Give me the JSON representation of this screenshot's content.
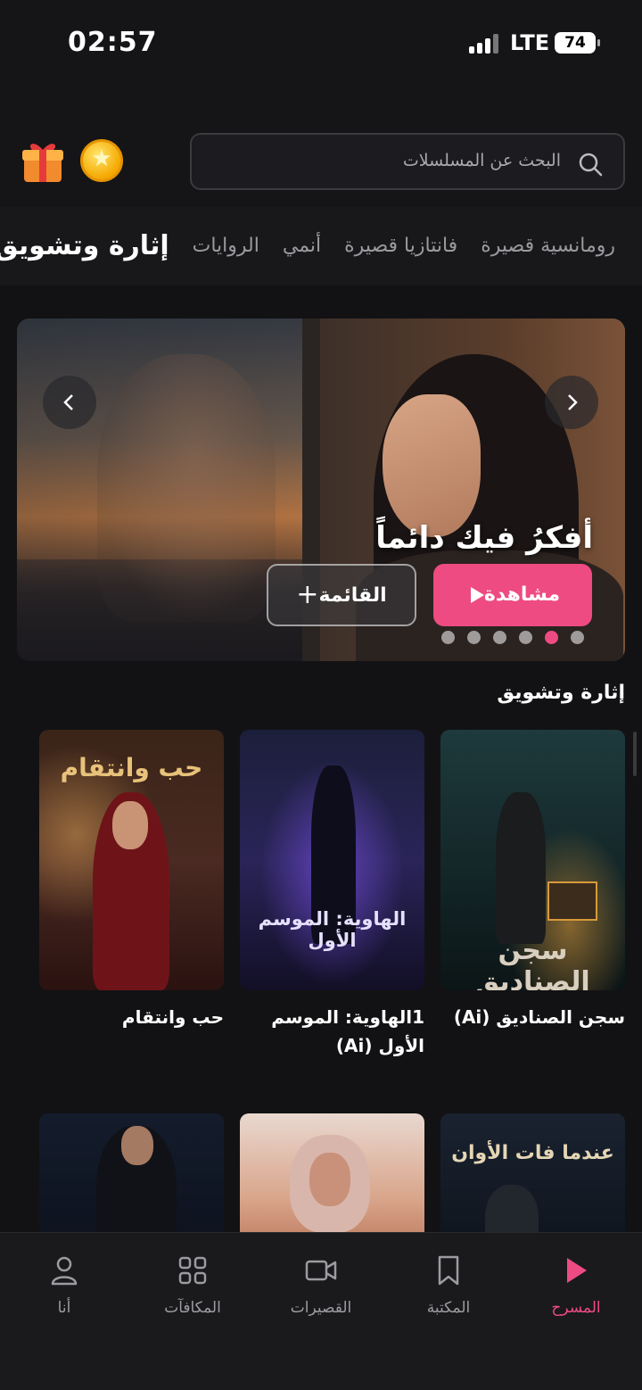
{
  "status_bar": {
    "time": "02:57",
    "network": "LTE",
    "battery": "74"
  },
  "header": {
    "search_placeholder": "البحث عن المسلسلات"
  },
  "tabs": [
    "إثارة وتشويق",
    "الروايات",
    "أنمي",
    "فانتازيا قصيرة",
    "رومانسية قصيرة"
  ],
  "hero": {
    "title": "أفكرُ فيك دائماً",
    "watch_label": "مشاهدة",
    "list_label": "القائمة",
    "slide_count": 6,
    "active_slide": 2
  },
  "section": {
    "title": "إثارة وتشويق",
    "cards": [
      {
        "title": "سجن الصناديق  (Ai)",
        "poster_text": "سجن الصناديق"
      },
      {
        "title": "1الهاوية: الموسم الأول (Ai)",
        "poster_text": "الهاوية: الموسم الأول"
      },
      {
        "title": "حب وانتقام",
        "poster_text": "حب وانتقام"
      }
    ],
    "row2_poster_text": "عندما فات الأوان"
  },
  "nav": {
    "items": [
      "المسرح",
      "المكتبة",
      "القصيرات",
      "المكافآت",
      "أنا"
    ],
    "active": "المسرح"
  },
  "colors": {
    "accent": "#ee4b82",
    "background": "#121214"
  }
}
